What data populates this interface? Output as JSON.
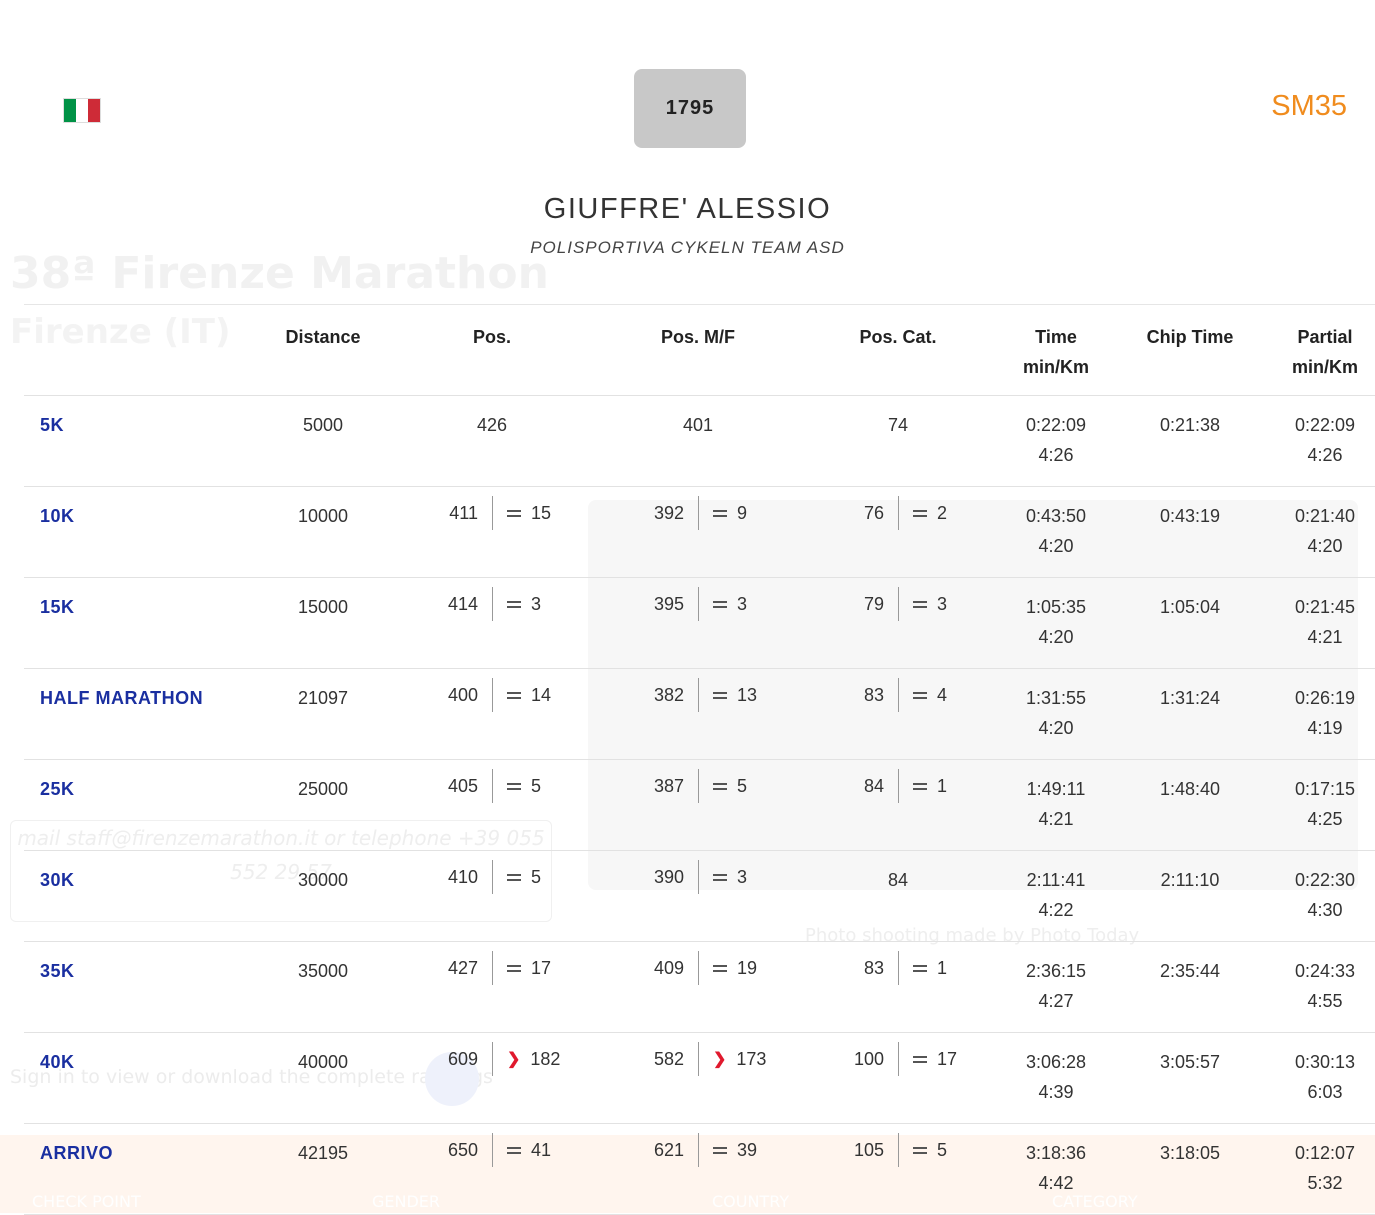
{
  "athlete": {
    "bib": "1795",
    "category": "SM35",
    "name": "GIUFFRE' ALESSIO",
    "team": "POLISPORTIVA CYKELN TEAM ASD",
    "flag": "italy-flag"
  },
  "background": {
    "event_title": "38ª Firenze Marathon",
    "event_city": "Firenze (IT)",
    "contact_line1": "mail staff@firenzemarathon.it or telephone +39 055",
    "contact_line2": "552 29 57",
    "photo_credit": "Photo shooting made by Photo Today",
    "signin_text": "Sign in to view or download the complete rankings",
    "footer": [
      "CHECK POINT",
      "GENDER",
      "COUNTRY",
      "CATEGORY"
    ]
  },
  "table": {
    "headers": {
      "distance": "Distance",
      "pos": "Pos.",
      "pos_mf": "Pos. M/F",
      "pos_cat": "Pos. Cat.",
      "time_1": "Time",
      "time_2": "min/Km",
      "chip": "Chip Time",
      "partial_1": "Partial",
      "partial_2": "min/Km"
    },
    "rows": [
      {
        "label": "5K",
        "distance": "5000",
        "pos": "426",
        "pos_trend": "",
        "pos_delta": "",
        "mf": "401",
        "mf_trend": "",
        "mf_delta": "",
        "cat": "74",
        "cat_trend": "",
        "cat_delta": "",
        "time": "0:22:09",
        "pace": "4:26",
        "chip": "0:21:38",
        "partial": "0:22:09",
        "partial_pace": "4:26"
      },
      {
        "label": "10K",
        "distance": "10000",
        "pos": "411",
        "pos_trend": "equal",
        "pos_delta": "15",
        "mf": "392",
        "mf_trend": "equal",
        "mf_delta": "9",
        "cat": "76",
        "cat_trend": "equal",
        "cat_delta": "2",
        "time": "0:43:50",
        "pace": "4:20",
        "chip": "0:43:19",
        "partial": "0:21:40",
        "partial_pace": "4:20"
      },
      {
        "label": "15K",
        "distance": "15000",
        "pos": "414",
        "pos_trend": "equal",
        "pos_delta": "3",
        "mf": "395",
        "mf_trend": "equal",
        "mf_delta": "3",
        "cat": "79",
        "cat_trend": "equal",
        "cat_delta": "3",
        "time": "1:05:35",
        "pace": "4:20",
        "chip": "1:05:04",
        "partial": "0:21:45",
        "partial_pace": "4:21"
      },
      {
        "label": "HALF MARATHON",
        "distance": "21097",
        "pos": "400",
        "pos_trend": "equal",
        "pos_delta": "14",
        "mf": "382",
        "mf_trend": "equal",
        "mf_delta": "13",
        "cat": "83",
        "cat_trend": "equal",
        "cat_delta": "4",
        "time": "1:31:55",
        "pace": "4:20",
        "chip": "1:31:24",
        "partial": "0:26:19",
        "partial_pace": "4:19"
      },
      {
        "label": "25K",
        "distance": "25000",
        "pos": "405",
        "pos_trend": "equal",
        "pos_delta": "5",
        "mf": "387",
        "mf_trend": "equal",
        "mf_delta": "5",
        "cat": "84",
        "cat_trend": "equal",
        "cat_delta": "1",
        "time": "1:49:11",
        "pace": "4:21",
        "chip": "1:48:40",
        "partial": "0:17:15",
        "partial_pace": "4:25"
      },
      {
        "label": "30K",
        "distance": "30000",
        "pos": "410",
        "pos_trend": "equal",
        "pos_delta": "5",
        "mf": "390",
        "mf_trend": "equal",
        "mf_delta": "3",
        "cat": "84",
        "cat_trend": "",
        "cat_delta": "",
        "time": "2:11:41",
        "pace": "4:22",
        "chip": "2:11:10",
        "partial": "0:22:30",
        "partial_pace": "4:30"
      },
      {
        "label": "35K",
        "distance": "35000",
        "pos": "427",
        "pos_trend": "equal",
        "pos_delta": "17",
        "mf": "409",
        "mf_trend": "equal",
        "mf_delta": "19",
        "cat": "83",
        "cat_trend": "equal",
        "cat_delta": "1",
        "time": "2:36:15",
        "pace": "4:27",
        "chip": "2:35:44",
        "partial": "0:24:33",
        "partial_pace": "4:55"
      },
      {
        "label": "40K",
        "distance": "40000",
        "pos": "609",
        "pos_trend": "down",
        "pos_delta": "182",
        "mf": "582",
        "mf_trend": "down",
        "mf_delta": "173",
        "cat": "100",
        "cat_trend": "equal",
        "cat_delta": "17",
        "time": "3:06:28",
        "pace": "4:39",
        "chip": "3:05:57",
        "partial": "0:30:13",
        "partial_pace": "6:03"
      },
      {
        "label": "ARRIVO",
        "distance": "42195",
        "pos": "650",
        "pos_trend": "equal",
        "pos_delta": "41",
        "mf": "621",
        "mf_trend": "equal",
        "mf_delta": "39",
        "cat": "105",
        "cat_trend": "equal",
        "cat_delta": "5",
        "time": "3:18:36",
        "pace": "4:42",
        "chip": "3:18:05",
        "partial": "0:12:07",
        "partial_pace": "5:32"
      }
    ]
  },
  "colors": {
    "category": "#f08c1e",
    "checkpoint_label": "#1a2fa0",
    "trend_down": "#e0192d",
    "bib_background": "#c8c8c8"
  }
}
